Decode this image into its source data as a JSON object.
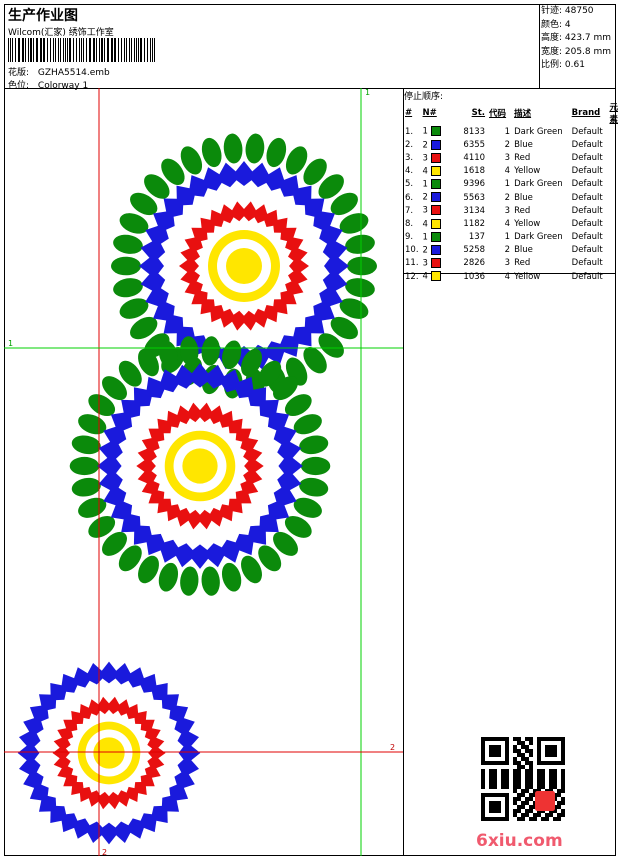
{
  "header": {
    "title": "生产作业图",
    "company": "Wilcom(汇家) 绣饰工作室",
    "design_label": "花版:",
    "design_value": "GZHA5514.emb",
    "colorway_label": "色位:",
    "colorway_value": "Colorway 1"
  },
  "stats": {
    "stitches": "针迹: 48750",
    "colors": "颜色: 4",
    "height": "高度: 423.7 mm",
    "width": "宽度: 205.8 mm",
    "scale": "比例: 0.61"
  },
  "stop_sequence": {
    "title": "停止顺序:",
    "headers": [
      "#",
      "N#",
      "St.",
      "代码",
      "描述",
      "Brand",
      "元素"
    ],
    "rows": [
      {
        "idx": "1.",
        "n": "1",
        "st": "8133",
        "code": "1",
        "desc": "Dark Green",
        "brand": "Default",
        "color": "#0b8a0b"
      },
      {
        "idx": "2.",
        "n": "2",
        "st": "6355",
        "code": "2",
        "desc": "Blue",
        "brand": "Default",
        "color": "#1a1adc"
      },
      {
        "idx": "3.",
        "n": "3",
        "st": "4110",
        "code": "3",
        "desc": "Red",
        "brand": "Default",
        "color": "#e81010"
      },
      {
        "idx": "4.",
        "n": "4",
        "st": "1618",
        "code": "4",
        "desc": "Yellow",
        "brand": "Default",
        "color": "#ffe600"
      },
      {
        "idx": "5.",
        "n": "1",
        "st": "9396",
        "code": "1",
        "desc": "Dark Green",
        "brand": "Default",
        "color": "#0b8a0b"
      },
      {
        "idx": "6.",
        "n": "2",
        "st": "5563",
        "code": "2",
        "desc": "Blue",
        "brand": "Default",
        "color": "#1a1adc"
      },
      {
        "idx": "7.",
        "n": "3",
        "st": "3134",
        "code": "3",
        "desc": "Red",
        "brand": "Default",
        "color": "#e81010"
      },
      {
        "idx": "8.",
        "n": "4",
        "st": "1182",
        "code": "4",
        "desc": "Yellow",
        "brand": "Default",
        "color": "#ffe600"
      },
      {
        "idx": "9.",
        "n": "1",
        "st": "137",
        "code": "1",
        "desc": "Dark Green",
        "brand": "Default",
        "color": "#0b8a0b"
      },
      {
        "idx": "10.",
        "n": "2",
        "st": "5258",
        "code": "2",
        "desc": "Blue",
        "brand": "Default",
        "color": "#1a1adc"
      },
      {
        "idx": "11.",
        "n": "3",
        "st": "2826",
        "code": "3",
        "desc": "Red",
        "brand": "Default",
        "color": "#e81010"
      },
      {
        "idx": "12.",
        "n": "4",
        "st": "1036",
        "code": "4",
        "desc": "Yellow",
        "brand": "Default",
        "color": "#ffe600"
      }
    ]
  },
  "axes": {
    "green_label_v": "1",
    "green_label_h": "1",
    "red_label_h": "2",
    "red_label_v": "2"
  },
  "colors": {
    "green": "#0b8a0b",
    "blue": "#1a1adc",
    "red": "#e81010",
    "yellow": "#ffe600",
    "guide_green": "#00d000",
    "guide_red": "#e00000"
  },
  "footer": {
    "site": "6xiu.com"
  }
}
